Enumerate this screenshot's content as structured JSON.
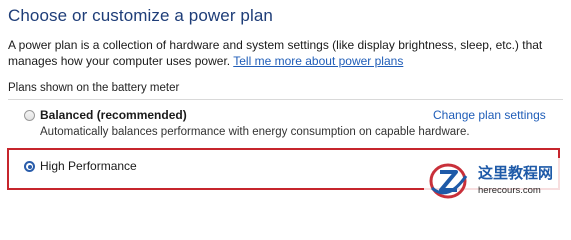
{
  "page": {
    "title": "Choose or customize a power plan",
    "intro_text": "A power plan is a collection of hardware and system settings (like display brightness, sleep, etc.) that manages how your computer uses power. ",
    "intro_link": "Tell me more about power plans"
  },
  "plans_section": {
    "label": "Plans shown on the battery meter",
    "plans": [
      {
        "name": "Balanced (recommended)",
        "description": "Automatically balances performance with energy consumption on capable hardware.",
        "selected": false,
        "action_link": "Change plan settings"
      },
      {
        "name": "High Performance",
        "selected": true
      }
    ]
  },
  "annotation": {
    "highlight_color": "#c6252c"
  },
  "watermark": {
    "logo_icon": "z-globe-logo",
    "title": "这里教程网",
    "subtitle": "herecours.com"
  }
}
